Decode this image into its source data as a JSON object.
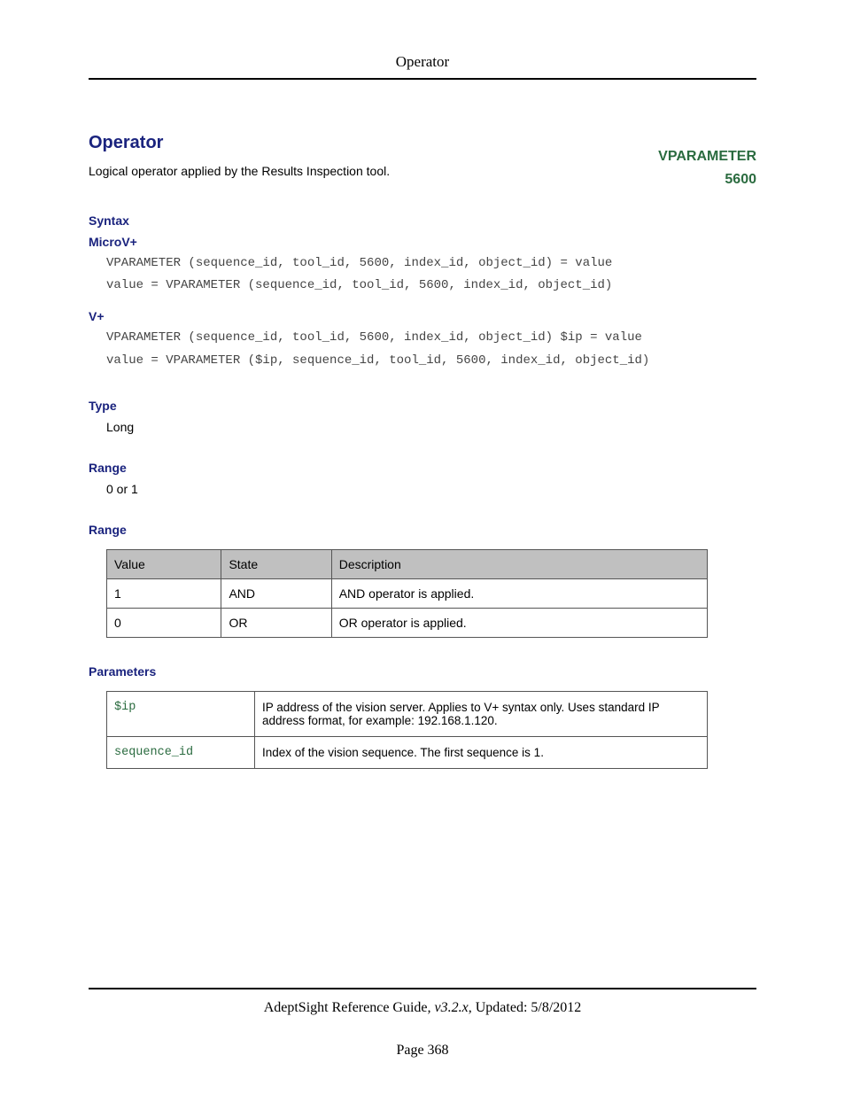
{
  "header": {
    "title": "Operator"
  },
  "title": "Operator",
  "tag": {
    "name": "VPARAMETER",
    "code": "5600"
  },
  "description": "Logical operator applied by the Results Inspection tool.",
  "sections": {
    "syntax": {
      "heading": "Syntax",
      "microv": {
        "label": "MicroV+",
        "line1": "VPARAMETER (sequence_id, tool_id, 5600, index_id, object_id) = value",
        "line2": "value = VPARAMETER (sequence_id, tool_id, 5600, index_id, object_id)"
      },
      "vplus": {
        "label": "V+",
        "line1": "VPARAMETER (sequence_id, tool_id, 5600, index_id, object_id) $ip = value",
        "line2": "value = VPARAMETER ($ip, sequence_id, tool_id, 5600, index_id, object_id)"
      }
    },
    "type": {
      "heading": "Type",
      "value": "Long"
    },
    "range1": {
      "heading": "Range",
      "value": "0 or 1"
    },
    "range2": {
      "heading": "Range",
      "headers": {
        "c1": "Value",
        "c2": "State",
        "c3": "Description"
      },
      "rows": [
        {
          "value": "1",
          "state": "AND",
          "desc": "AND operator is applied."
        },
        {
          "value": "0",
          "state": "OR",
          "desc": "OR operator is applied."
        }
      ]
    },
    "parameters": {
      "heading": "Parameters",
      "rows": [
        {
          "name": "$ip",
          "desc": "IP address of the vision server. Applies to V+ syntax only. Uses standard IP address format, for example: 192.168.1.120."
        },
        {
          "name": "sequence_id",
          "desc": "Index of the vision sequence. The first sequence is 1."
        }
      ]
    }
  },
  "footer": {
    "guide": "AdeptSight Reference Guide",
    "version": ", v3.2.x",
    "updated": ", Updated: 5/8/2012",
    "page": "Page 368"
  }
}
